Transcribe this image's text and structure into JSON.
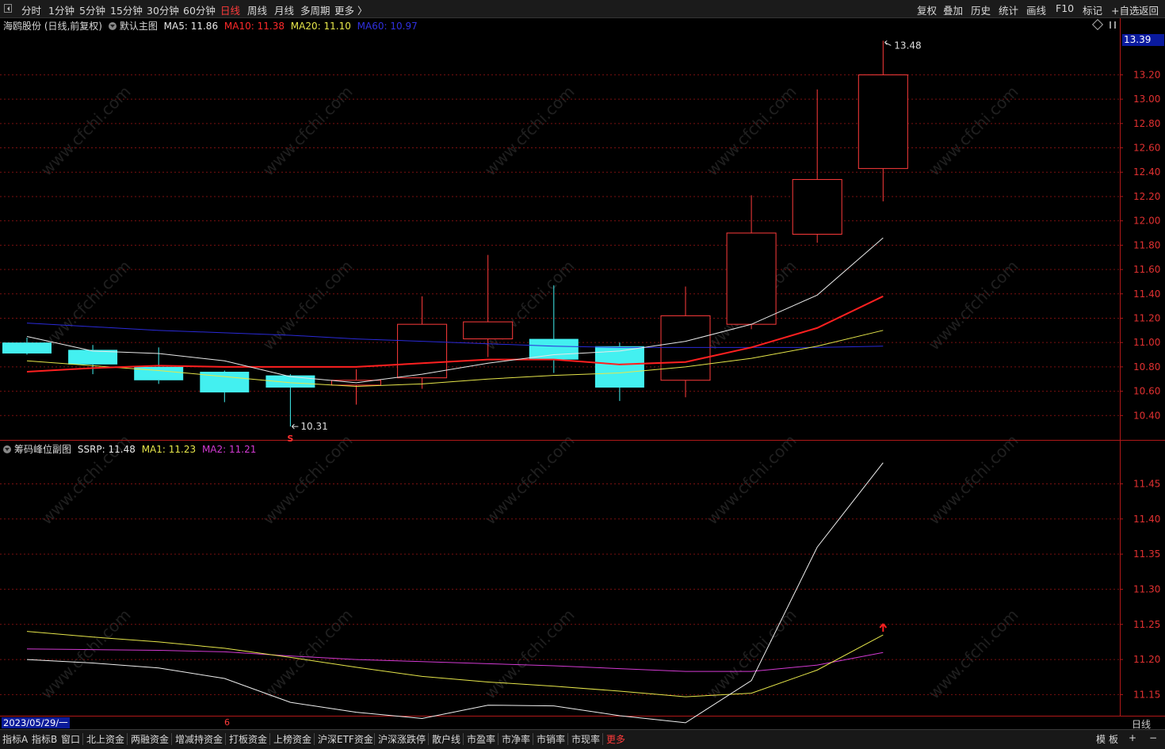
{
  "toolbar": {
    "left_items": [
      "分时",
      "1分钟",
      "5分钟",
      "15分钟",
      "30分钟",
      "60分钟",
      "日线",
      "周线",
      "月线",
      "多周期",
      "更多 〉"
    ],
    "active_item": "日线",
    "right_items": [
      "复权",
      "叠加",
      "历史",
      "统计",
      "画线",
      "F10",
      "标记",
      "+自选",
      "返回"
    ]
  },
  "main_legend": {
    "stock_name": "海鸥股份 (日线,前复权)",
    "template_name": "默认主图",
    "ma5": "MA5: 11.86",
    "ma10": "MA10: 11.38",
    "ma20": "MA20: 11.10",
    "ma60": "MA60: 10.97"
  },
  "sub_legend": {
    "name": "筹码峰位副图",
    "ssrp": "SSRP: 11.48",
    "ma1": "MA1: 11.23",
    "ma2": "MA2: 11.21"
  },
  "current_price_tag": "13.39",
  "high_label": "13.48",
  "low_label": "10.31",
  "marker_s": "S",
  "axis_labels": {
    "main": [
      "13.20",
      "13.00",
      "12.80",
      "12.60",
      "12.40",
      "12.20",
      "12.00",
      "11.80",
      "11.60",
      "11.40",
      "11.20",
      "11.00",
      "10.80",
      "10.60",
      "10.40"
    ],
    "sub": [
      "11.45",
      "11.40",
      "11.35",
      "11.30",
      "11.25",
      "11.20",
      "11.15"
    ]
  },
  "date_label": "2023/05/29/一",
  "month_marker": "6",
  "period_label": "日线",
  "bottom_tabs": [
    "指标A",
    "指标B",
    "窗口",
    "北上资金",
    "两融资金",
    "增减持资金",
    "打板资金",
    "上榜资金",
    "沪深ETF资金",
    "沪深涨跌停",
    "散户线",
    "市盈率",
    "市净率",
    "市销率",
    "市现率",
    "更多"
  ],
  "bottom_active": "更多",
  "bottom_right": [
    "模",
    "板",
    "+",
    "−"
  ],
  "watermark": "www.cfchi.com",
  "colors": {
    "up": "#ff3b3b",
    "down": "#43f0f0",
    "ma5": "#e8e8e8",
    "ma10": "#ff2020",
    "ma20": "#e6e64a",
    "ma60": "#2a2ad8",
    "ssrp": "#f0f0f0",
    "ma1": "#e6e64a",
    "ma2": "#d23ad2",
    "grid": "#7a1010",
    "frame": "#b01818"
  },
  "chart_data": [
    {
      "type": "candlestick",
      "title": "海鸥股份 (日线,前复权)",
      "ylim": [
        10.2,
        13.6
      ],
      "candles": [
        {
          "o": 10.91,
          "h": 11.04,
          "l": 10.9,
          "c": 11.0,
          "dir": "down"
        },
        {
          "o": 10.94,
          "h": 10.98,
          "l": 10.74,
          "c": 10.82,
          "dir": "down"
        },
        {
          "o": 10.8,
          "h": 10.96,
          "l": 10.66,
          "c": 10.69,
          "dir": "down"
        },
        {
          "o": 10.76,
          "h": 10.77,
          "l": 10.51,
          "c": 10.59,
          "dir": "down"
        },
        {
          "o": 10.73,
          "h": 10.74,
          "l": 10.31,
          "c": 10.63,
          "dir": "down"
        },
        {
          "o": 10.65,
          "h": 10.78,
          "l": 10.49,
          "c": 10.69,
          "dir": "up"
        },
        {
          "o": 10.71,
          "h": 11.38,
          "l": 10.62,
          "c": 11.15,
          "dir": "up"
        },
        {
          "o": 11.03,
          "h": 11.72,
          "l": 10.88,
          "c": 11.17,
          "dir": "up"
        },
        {
          "o": 11.03,
          "h": 11.47,
          "l": 10.75,
          "c": 10.86,
          "dir": "down"
        },
        {
          "o": 10.97,
          "h": 11.0,
          "l": 10.52,
          "c": 10.63,
          "dir": "down"
        },
        {
          "o": 10.69,
          "h": 11.46,
          "l": 10.55,
          "c": 11.22,
          "dir": "up"
        },
        {
          "o": 11.15,
          "h": 12.21,
          "l": 11.11,
          "c": 11.9,
          "dir": "up"
        },
        {
          "o": 11.89,
          "h": 13.08,
          "l": 11.82,
          "c": 12.34,
          "dir": "up"
        },
        {
          "o": 12.43,
          "h": 13.48,
          "l": 12.16,
          "c": 13.2,
          "dir": "up"
        }
      ],
      "series": [
        {
          "name": "MA5",
          "values": [
            11.05,
            10.93,
            10.91,
            10.85,
            10.72,
            10.67,
            10.74,
            10.83,
            10.9,
            10.93,
            11.01,
            11.15,
            11.39,
            11.86
          ]
        },
        {
          "name": "MA10",
          "values": [
            10.76,
            10.79,
            10.81,
            10.8,
            10.8,
            10.8,
            10.83,
            10.86,
            10.86,
            10.82,
            10.84,
            10.96,
            11.12,
            11.38
          ]
        },
        {
          "name": "MA20",
          "values": [
            10.85,
            10.81,
            10.77,
            10.72,
            10.67,
            10.64,
            10.66,
            10.7,
            10.73,
            10.75,
            10.8,
            10.87,
            10.97,
            11.1
          ]
        },
        {
          "name": "MA60",
          "values": [
            11.16,
            11.13,
            11.1,
            11.08,
            11.06,
            11.03,
            11.01,
            10.99,
            10.97,
            10.96,
            10.96,
            10.96,
            10.96,
            10.97
          ]
        }
      ]
    },
    {
      "type": "line",
      "title": "筹码峰位副图",
      "ylim": [
        11.12,
        11.49
      ],
      "series": [
        {
          "name": "SSRP",
          "values": [
            11.2,
            11.195,
            11.188,
            11.173,
            11.139,
            11.125,
            11.116,
            11.135,
            11.134,
            11.12,
            11.11,
            11.17,
            11.36,
            11.48
          ]
        },
        {
          "name": "MA1",
          "values": [
            11.24,
            11.232,
            11.225,
            11.216,
            11.203,
            11.189,
            11.176,
            11.168,
            11.162,
            11.155,
            11.147,
            11.152,
            11.185,
            11.235
          ]
        },
        {
          "name": "MA2",
          "values": [
            11.215,
            11.214,
            11.213,
            11.211,
            11.205,
            11.2,
            11.197,
            11.194,
            11.191,
            11.187,
            11.183,
            11.183,
            11.192,
            11.21
          ]
        }
      ]
    }
  ]
}
